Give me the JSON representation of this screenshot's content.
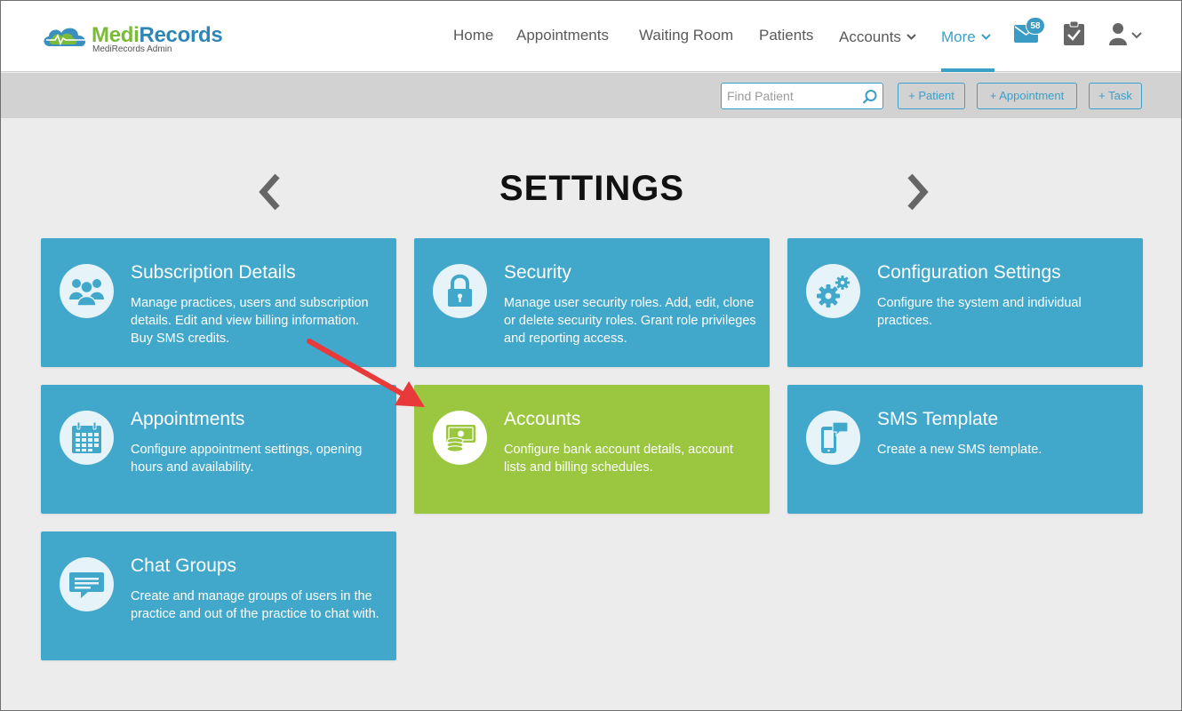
{
  "app": {
    "logo_part1": "Medi",
    "logo_part2": "Records",
    "logo_subtitle": "MediRecords Admin"
  },
  "nav": {
    "home": "Home",
    "appointments": "Appointments",
    "waiting_room": "Waiting Room",
    "patients": "Patients",
    "accounts": "Accounts",
    "more": "More",
    "message_count": "58"
  },
  "toolbar": {
    "search_placeholder": "Find Patient",
    "add_patient": "+ Patient",
    "add_appointment": "+ Appointment",
    "add_task": "+ Task"
  },
  "page": {
    "title": "SETTINGS"
  },
  "cards": [
    {
      "title": "Subscription Details",
      "description": "Manage practices, users and subscription details. Edit and view billing information. Buy SMS credits.",
      "icon": "users-icon"
    },
    {
      "title": "Security",
      "description": "Manage user security roles. Add, edit, clone or delete security roles. Grant role privileges and reporting access.",
      "icon": "lock-icon"
    },
    {
      "title": "Configuration Settings",
      "description": "Configure the system and individual practices.",
      "icon": "gears-icon"
    },
    {
      "title": "Appointments",
      "description": "Configure appointment settings, opening hours and availability.",
      "icon": "calendar-icon"
    },
    {
      "title": "Accounts",
      "description": "Configure bank account details, account lists and billing schedules.",
      "icon": "money-icon"
    },
    {
      "title": "SMS Template",
      "description": "Create a new SMS template.",
      "icon": "phone-message-icon"
    },
    {
      "title": "Chat Groups",
      "description": "Create and manage groups of users in the practice and out of the practice to chat with.",
      "icon": "chat-bubble-icon"
    }
  ],
  "colors": {
    "card_blue": "#41a8cb",
    "card_highlight_green": "#9ac73f",
    "accent": "#3aa0c8",
    "annotation_arrow": "#e8393b"
  }
}
